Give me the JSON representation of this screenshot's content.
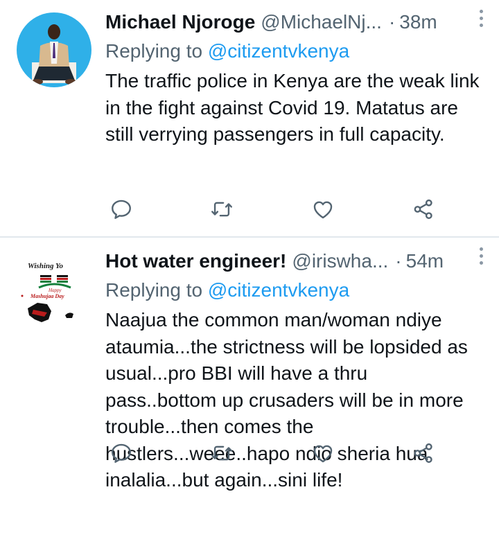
{
  "tweets": [
    {
      "name": "Michael Njoroge",
      "handle": "@MichaelNj...",
      "dot": "·",
      "time": "38m",
      "replying_prefix": "Replying to ",
      "replying_to": "@citizentvkenya",
      "text": "The traffic police in Kenya are the weak link in the fight against Covid 19. Matatus are still verrying passengers in full capacity."
    },
    {
      "name": "Hot water engineer!",
      "handle": "@iriswha...",
      "dot": "·",
      "time": "54m",
      "replying_prefix": "Replying to ",
      "replying_to": "@citizentvkenya",
      "text": "Naajua the common man/woman ndiye ataumia...the strictness will be lopsided as usual...pro BBI will have a thru pass..bottom up crusaders will be in more trouble...then comes the hustlers...weee..hapo ndio sheria hua inalalia...but again...sini life!",
      "avatar_lettering": [
        "Wishing Yo",
        "Happy",
        "Mashujaa Day"
      ]
    }
  ],
  "icons": [
    "reply-icon",
    "retweet-icon",
    "like-icon",
    "share-icon",
    "more-icon"
  ],
  "colors": {
    "name": "#0f1419",
    "secondary": "#536471",
    "mention": "#1d9bf0",
    "icon": "#536471",
    "divider": "#e1e8ed"
  }
}
